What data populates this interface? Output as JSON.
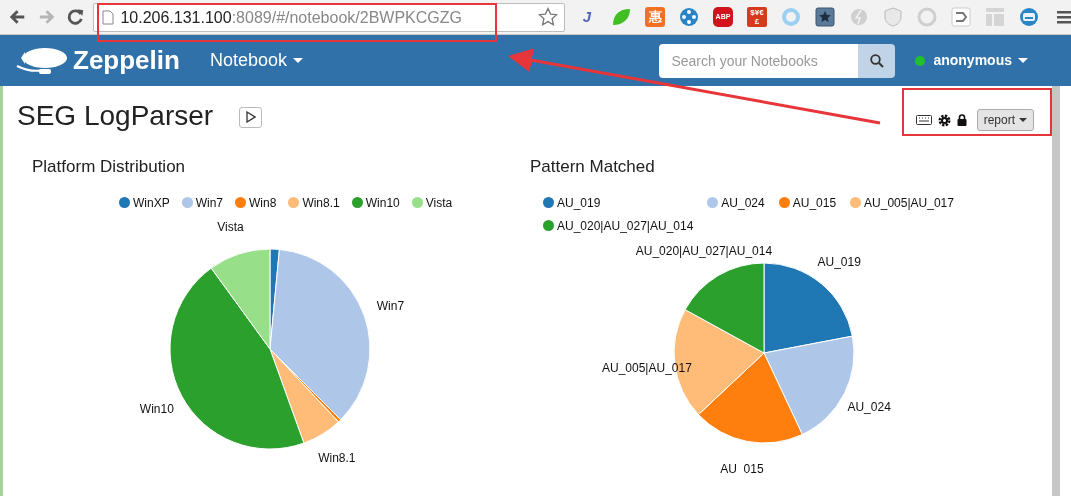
{
  "browser": {
    "url_host": "10.206.131.100",
    "url_rest": ":8089/#/notebook/2BWPKCGZG",
    "forward_disabled": true,
    "extensions": [
      {
        "kind": "json",
        "label": "J"
      },
      {
        "kind": "leaf"
      },
      {
        "kind": "hui",
        "label": "惠"
      },
      {
        "kind": "reel"
      },
      {
        "kind": "abp",
        "label": "ABP"
      },
      {
        "kind": "currency",
        "label": "$¥€£"
      },
      {
        "kind": "ring"
      },
      {
        "kind": "bookmark"
      },
      {
        "kind": "ball"
      },
      {
        "kind": "shield"
      },
      {
        "kind": "swirl"
      },
      {
        "kind": "exit"
      },
      {
        "kind": "layout"
      },
      {
        "kind": "robot"
      }
    ]
  },
  "navbar": {
    "brand": "Zeppelin",
    "menu": "Notebook",
    "search_placeholder": "Search your Notebooks",
    "user": "anonymous",
    "user_online": true
  },
  "notebook": {
    "title": "SEG LogParser",
    "mode": "report"
  },
  "paragraphs": [
    {
      "title": "Platform Distribution",
      "chart_data": {
        "type": "pie",
        "categories": [
          "WinXP",
          "Win7",
          "Win8",
          "Win8.1",
          "Win10",
          "Vista"
        ],
        "colors": [
          "#1f77b4",
          "#aec7e8",
          "#ff7f0e",
          "#ffbb78",
          "#2ca02c",
          "#98df8a"
        ],
        "values": [
          1.5,
          36,
          0.5,
          6.5,
          45.5,
          10
        ],
        "legend": "top"
      }
    },
    {
      "title": "Pattern Matched",
      "chart_data": {
        "type": "pie",
        "categories": [
          "AU_019",
          "AU_024",
          "AU_015",
          "AU_005|AU_017",
          "AU_020|AU_027|AU_014"
        ],
        "colors": [
          "#1f77b4",
          "#aec7e8",
          "#ff7f0e",
          "#ffbb78",
          "#2ca02c"
        ],
        "values": [
          22,
          21,
          20,
          20,
          17
        ],
        "legend": "top"
      }
    }
  ]
}
